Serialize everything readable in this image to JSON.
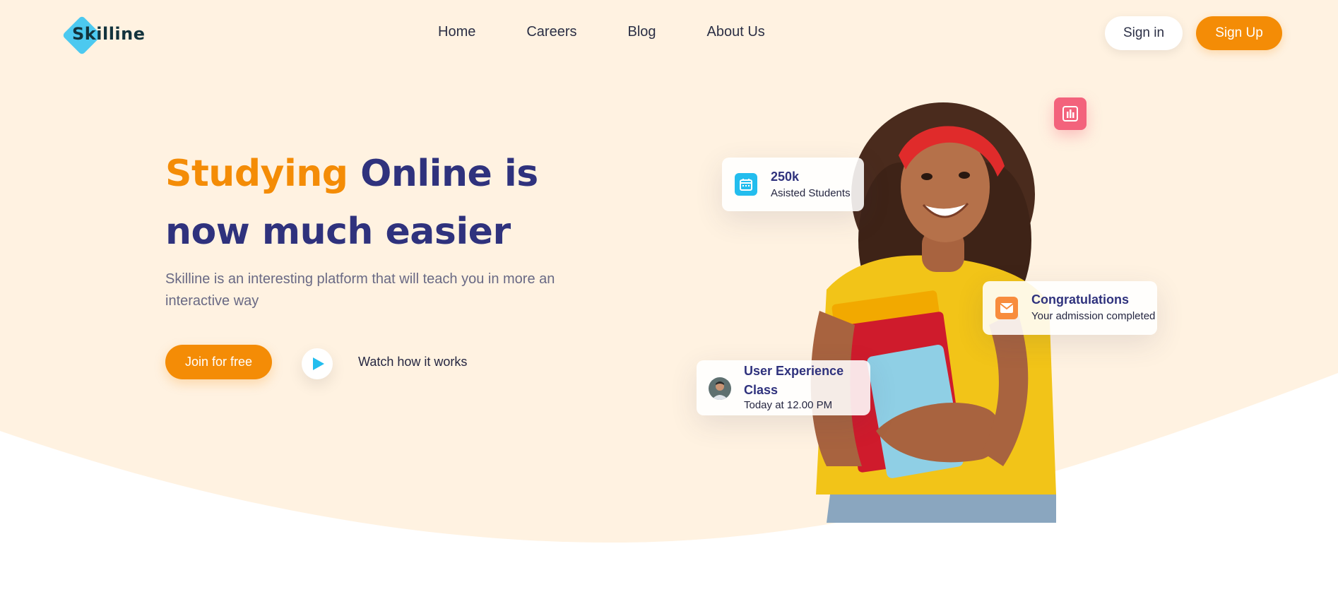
{
  "brand": {
    "name": "Skilline",
    "diamond_color": "#4cc9f0"
  },
  "colors": {
    "accent": "#f48c06",
    "navy": "#2f327d",
    "hero_bg": "#fff2e1"
  },
  "nav": {
    "items": [
      {
        "label": "Home"
      },
      {
        "label": "Careers"
      },
      {
        "label": "Blog"
      },
      {
        "label": "About Us"
      }
    ],
    "signin_label": "Sign in",
    "signup_label": "Sign Up"
  },
  "hero": {
    "headline_accent": "Studying",
    "headline_rest_1": " Online is",
    "headline_line_2": "now much easier",
    "subtext": "Skilline is an interesting platform that will teach you in more an interactive way",
    "join_label": "Join for free",
    "watch_label": "Watch how it works"
  },
  "cards": {
    "students": {
      "icon": "calendar-icon",
      "title": "250k",
      "subtitle": "Asisted Students"
    },
    "congrats": {
      "icon": "mail-icon",
      "title": "Congratulations",
      "subtitle": "Your admission completed"
    },
    "class": {
      "icon": "avatar",
      "title_line_1": "User Experience",
      "title_line_2": "Class",
      "subtitle": "Today at 12.00 PM"
    },
    "chart_badge": {
      "icon": "bar-chart-icon"
    }
  }
}
